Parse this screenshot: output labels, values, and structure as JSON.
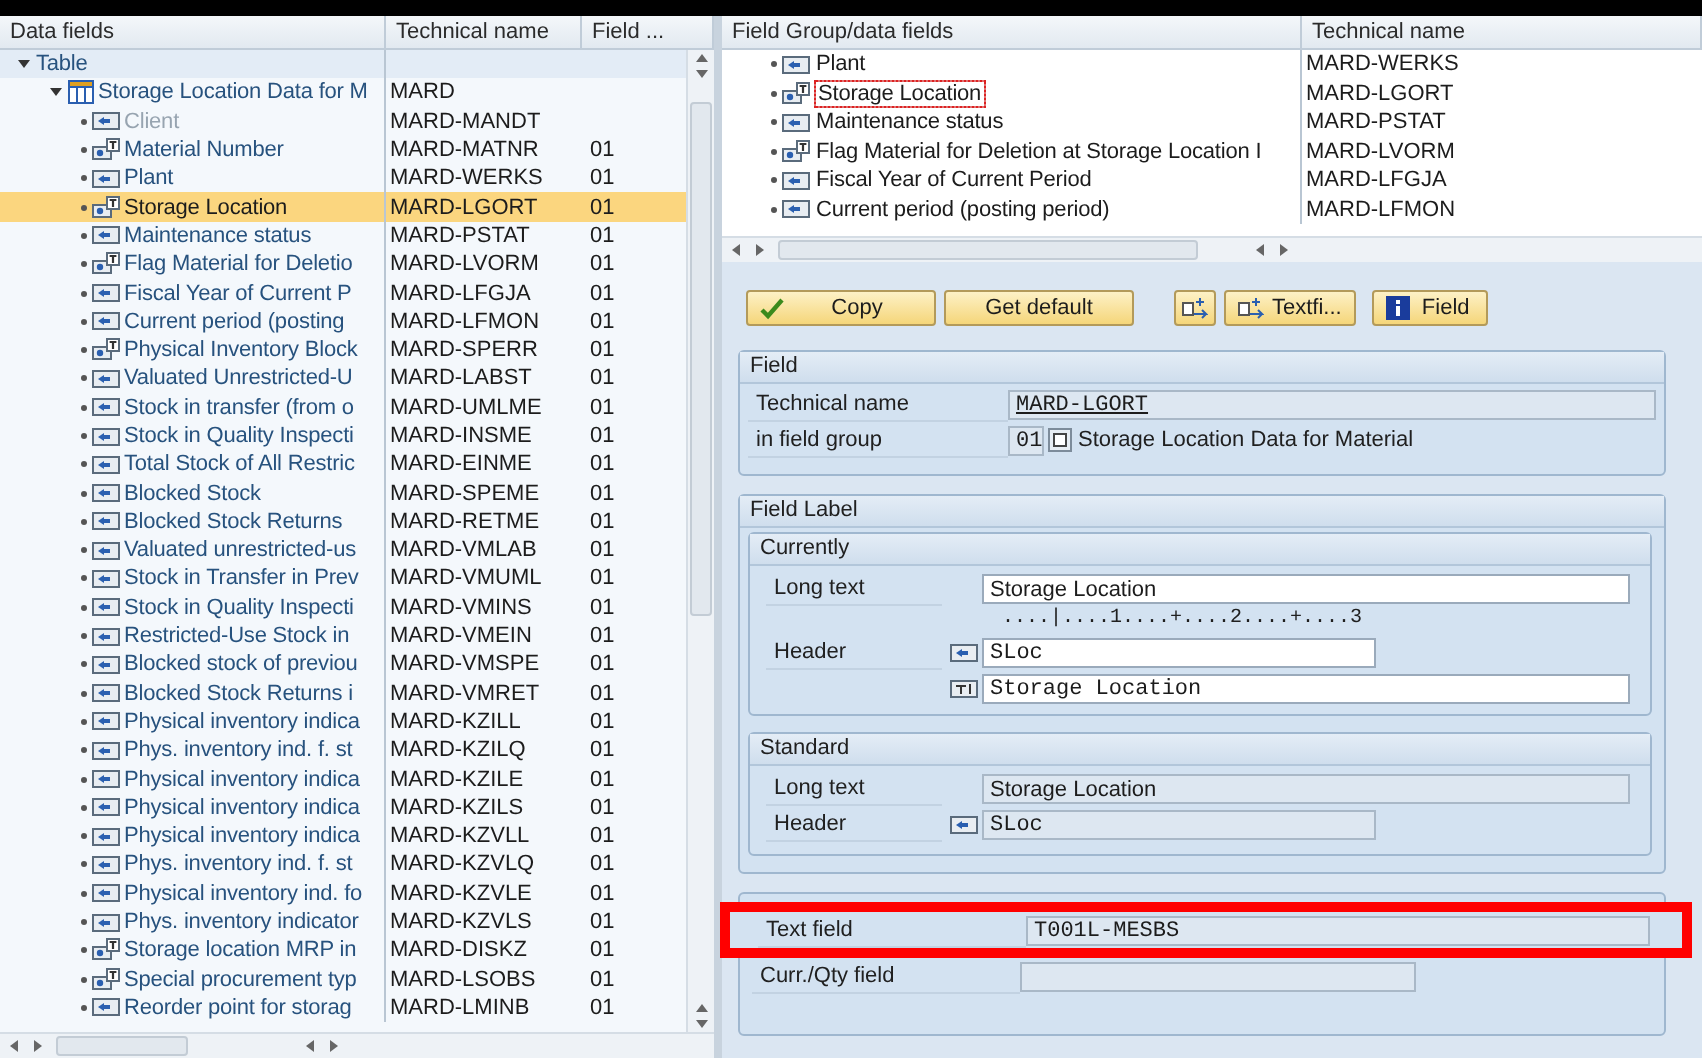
{
  "left_tree": {
    "columns": [
      "Data fields",
      "Technical name",
      "Field ..."
    ],
    "root": {
      "label": "Table",
      "expanded": true,
      "children": [
        {
          "label": "Storage Location Data for M",
          "technical_name": "MARD",
          "expanded": true,
          "children": [
            {
              "label": "Client",
              "technical_name": "MARD-MANDT",
              "kind": "field",
              "selected": false,
              "disabled": true
            },
            {
              "label": "Material Number",
              "technical_name": "MARD-MATNR",
              "field_group": "01",
              "kind": "text-field",
              "selected": false,
              "disabled": false
            },
            {
              "label": "Plant",
              "technical_name": "MARD-WERKS",
              "field_group": "01",
              "kind": "field",
              "selected": false,
              "disabled": false
            },
            {
              "label": "Storage Location",
              "technical_name": "MARD-LGORT",
              "field_group": "01",
              "kind": "text-field",
              "selected": true,
              "disabled": false
            },
            {
              "label": "Maintenance status",
              "technical_name": "MARD-PSTAT",
              "field_group": "01",
              "kind": "field",
              "selected": false,
              "disabled": false
            },
            {
              "label": "Flag Material for Deletio",
              "technical_name": "MARD-LVORM",
              "field_group": "01",
              "kind": "text-field",
              "selected": false,
              "disabled": false
            },
            {
              "label": "Fiscal Year of Current P",
              "technical_name": "MARD-LFGJA",
              "field_group": "01",
              "kind": "field",
              "selected": false,
              "disabled": false
            },
            {
              "label": "Current period (posting",
              "technical_name": "MARD-LFMON",
              "field_group": "01",
              "kind": "field",
              "selected": false,
              "disabled": false
            },
            {
              "label": "Physical Inventory Block",
              "technical_name": "MARD-SPERR",
              "field_group": "01",
              "kind": "text-field",
              "selected": false,
              "disabled": false
            },
            {
              "label": "Valuated Unrestricted-U",
              "technical_name": "MARD-LABST",
              "field_group": "01",
              "kind": "field",
              "selected": false,
              "disabled": false
            },
            {
              "label": "Stock in transfer (from o",
              "technical_name": "MARD-UMLME",
              "field_group": "01",
              "kind": "field",
              "selected": false,
              "disabled": false
            },
            {
              "label": "Stock in Quality Inspecti",
              "technical_name": "MARD-INSME",
              "field_group": "01",
              "kind": "field",
              "selected": false,
              "disabled": false
            },
            {
              "label": "Total Stock of All Restric",
              "technical_name": "MARD-EINME",
              "field_group": "01",
              "kind": "field",
              "selected": false,
              "disabled": false
            },
            {
              "label": "Blocked Stock",
              "technical_name": "MARD-SPEME",
              "field_group": "01",
              "kind": "field",
              "selected": false,
              "disabled": false
            },
            {
              "label": "Blocked Stock Returns",
              "technical_name": "MARD-RETME",
              "field_group": "01",
              "kind": "field",
              "selected": false,
              "disabled": false
            },
            {
              "label": "Valuated unrestricted-us",
              "technical_name": "MARD-VMLAB",
              "field_group": "01",
              "kind": "field",
              "selected": false,
              "disabled": false
            },
            {
              "label": "Stock in Transfer in Prev",
              "technical_name": "MARD-VMUML",
              "field_group": "01",
              "kind": "field",
              "selected": false,
              "disabled": false
            },
            {
              "label": "Stock in Quality Inspecti",
              "technical_name": "MARD-VMINS",
              "field_group": "01",
              "kind": "field",
              "selected": false,
              "disabled": false
            },
            {
              "label": "Restricted-Use Stock in",
              "technical_name": "MARD-VMEIN",
              "field_group": "01",
              "kind": "field",
              "selected": false,
              "disabled": false
            },
            {
              "label": "Blocked stock of previou",
              "technical_name": "MARD-VMSPE",
              "field_group": "01",
              "kind": "field",
              "selected": false,
              "disabled": false
            },
            {
              "label": "Blocked Stock Returns i",
              "technical_name": "MARD-VMRET",
              "field_group": "01",
              "kind": "field",
              "selected": false,
              "disabled": false
            },
            {
              "label": "Physical inventory indica",
              "technical_name": "MARD-KZILL",
              "field_group": "01",
              "kind": "field",
              "selected": false,
              "disabled": false
            },
            {
              "label": "Phys. inventory ind. f. st",
              "technical_name": "MARD-KZILQ",
              "field_group": "01",
              "kind": "field",
              "selected": false,
              "disabled": false
            },
            {
              "label": "Physical inventory indica",
              "technical_name": "MARD-KZILE",
              "field_group": "01",
              "kind": "field",
              "selected": false,
              "disabled": false
            },
            {
              "label": "Physical inventory indica",
              "technical_name": "MARD-KZILS",
              "field_group": "01",
              "kind": "field",
              "selected": false,
              "disabled": false
            },
            {
              "label": "Physical inventory indica",
              "technical_name": "MARD-KZVLL",
              "field_group": "01",
              "kind": "field",
              "selected": false,
              "disabled": false
            },
            {
              "label": "Phys. inventory ind. f. st",
              "technical_name": "MARD-KZVLQ",
              "field_group": "01",
              "kind": "field",
              "selected": false,
              "disabled": false
            },
            {
              "label": "Physical inventory ind. fo",
              "technical_name": "MARD-KZVLE",
              "field_group": "01",
              "kind": "field",
              "selected": false,
              "disabled": false
            },
            {
              "label": "Phys. inventory indicator",
              "technical_name": "MARD-KZVLS",
              "field_group": "01",
              "kind": "field",
              "selected": false,
              "disabled": false
            },
            {
              "label": "Storage location MRP in",
              "technical_name": "MARD-DISKZ",
              "field_group": "01",
              "kind": "text-field",
              "selected": false,
              "disabled": false
            },
            {
              "label": "Special procurement typ",
              "technical_name": "MARD-LSOBS",
              "field_group": "01",
              "kind": "text-field",
              "selected": false,
              "disabled": false
            },
            {
              "label": "Reorder point for storag",
              "technical_name": "MARD-LMINB",
              "field_group": "01",
              "kind": "field",
              "selected": false,
              "disabled": false
            }
          ]
        }
      ]
    }
  },
  "right_tree": {
    "columns": [
      "Field Group/data fields",
      "Technical name"
    ],
    "items": [
      {
        "label": "Plant",
        "technical_name": "MARD-WERKS",
        "kind": "field",
        "focused": false
      },
      {
        "label": "Storage Location",
        "technical_name": "MARD-LGORT",
        "kind": "text-field",
        "focused": true
      },
      {
        "label": "Maintenance status",
        "technical_name": "MARD-PSTAT",
        "kind": "field",
        "focused": false
      },
      {
        "label": "Flag Material for Deletion at Storage Location I",
        "technical_name": "MARD-LVORM",
        "kind": "text-field",
        "focused": false
      },
      {
        "label": "Fiscal Year of Current Period",
        "technical_name": "MARD-LFGJA",
        "kind": "field",
        "focused": false
      },
      {
        "label": "Current period (posting period)",
        "technical_name": "MARD-LFMON",
        "kind": "field",
        "focused": false
      }
    ]
  },
  "toolbar": [
    {
      "kind": "copy",
      "label": "Copy"
    },
    {
      "kind": "plain",
      "label": "Get default"
    },
    {
      "kind": "assign"
    },
    {
      "kind": "textfield",
      "label": "Textfi..."
    },
    {
      "kind": "info",
      "label": "Field"
    }
  ],
  "field": {
    "title": "Field",
    "technical_name_label": "Technical name",
    "technical_name": "MARD-LGORT",
    "group_label": "in field group",
    "group_number": "01",
    "group_name": "Storage Location Data for Material"
  },
  "field_label": {
    "title": "Field Label",
    "currently": {
      "title": "Currently",
      "long_text_label": "Long text",
      "long_text": "Storage Location",
      "ruler": "....|....1....+....2....+....3",
      "header_label": "Header",
      "header": "SLoc",
      "header_text": "Storage Location"
    },
    "standard": {
      "title": "Standard",
      "long_text_label": "Long text",
      "long_text": "Storage Location",
      "header_label": "Header",
      "header": "SLoc"
    }
  },
  "references": {
    "rows": [
      {
        "label": "Text field",
        "value": "T001L-MESBS",
        "highlighted": true
      },
      {
        "label": "Curr./Qty field",
        "value": "",
        "highlighted": false
      }
    ]
  }
}
